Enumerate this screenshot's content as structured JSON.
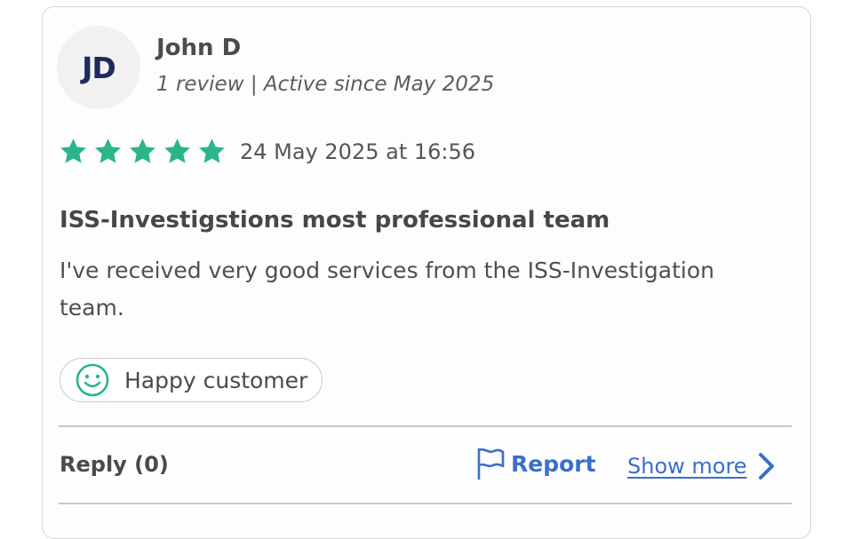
{
  "author": {
    "initials": "JD",
    "name": "John D",
    "meta": "1 review | Active since May 2025"
  },
  "review": {
    "rating": 5,
    "rating_max": 5,
    "star_color": "#2bb58a",
    "date": "24 May 2025 at 16:56",
    "title": "ISS-Investigstions most professional team",
    "body": "I've received very good services from the ISS-Investigation team."
  },
  "badge": {
    "icon": "smiley-icon",
    "label": "Happy customer"
  },
  "footer": {
    "reply_label": "Reply (0)",
    "report_icon": "flag-icon",
    "report_label": "Report",
    "show_more_label": "Show more",
    "show_more_icon": "chevron-right-icon",
    "link_color": "#3a6fc8"
  }
}
